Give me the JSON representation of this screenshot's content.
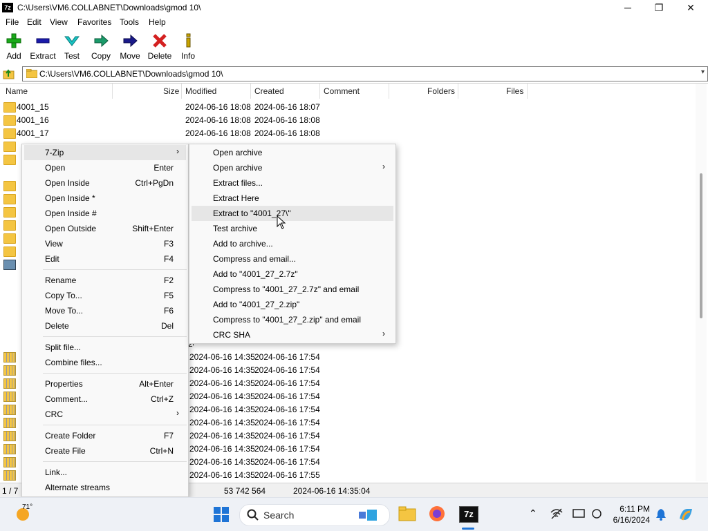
{
  "window": {
    "app_icon_label": "7z",
    "title": "C:\\Users\\VM6.COLLABNET\\Downloads\\gmod 10\\",
    "minimize_glyph": "─",
    "maximize_glyph": "❐",
    "close_glyph": "✕"
  },
  "menubar": [
    "File",
    "Edit",
    "View",
    "Favorites",
    "Tools",
    "Help"
  ],
  "toolbar": [
    {
      "label": "Add",
      "icon": "plus-icon",
      "color": "#1aaa1a"
    },
    {
      "label": "Extract",
      "icon": "minus-icon",
      "color": "#1a1aaa"
    },
    {
      "label": "Test",
      "icon": "check-icon",
      "color": "#19b3b3"
    },
    {
      "label": "Copy",
      "icon": "arrow-right-icon",
      "color": "#1a9a6a"
    },
    {
      "label": "Move",
      "icon": "arrow-right-icon",
      "color": "#1a1a8a"
    },
    {
      "label": "Delete",
      "icon": "x-icon",
      "color": "#d42020"
    },
    {
      "label": "Info",
      "icon": "info-icon",
      "color": "#c8a400"
    }
  ],
  "address": {
    "path": "C:\\Users\\VM6.COLLABNET\\Downloads\\gmod 10\\"
  },
  "columns": [
    "Name",
    "Size",
    "Modified",
    "Created",
    "Comment",
    "Folders",
    "Files"
  ],
  "rows": [
    {
      "name": "4001_15",
      "modified": "2024-06-16 18:08",
      "created": "2024-06-16 18:07"
    },
    {
      "name": "4001_16",
      "modified": "2024-06-16 18:08",
      "created": "2024-06-16 18:08"
    },
    {
      "name": "4001_17",
      "modified": "2024-06-16 18:08",
      "created": "2024-06-16 18:08"
    }
  ],
  "lower_rows": [
    {
      "modified": "2024-06-16 14:35",
      "created": "2024-06-16 17:54"
    },
    {
      "modified": "2024-06-16 14:35",
      "created": "2024-06-16 17:54"
    },
    {
      "modified": "2024-06-16 14:35",
      "created": "2024-06-16 17:54"
    },
    {
      "modified": "2024-06-16 14:35",
      "created": "2024-06-16 17:54"
    },
    {
      "modified": "2024-06-16 14:35",
      "created": "2024-06-16 17:54"
    },
    {
      "modified": "2024-06-16 14:35",
      "created": "2024-06-16 17:54"
    },
    {
      "modified": "2024-06-16 14:35",
      "created": "2024-06-16 17:54"
    },
    {
      "modified": "2024-06-16 14:35",
      "created": "2024-06-16 17:54"
    },
    {
      "modified": "2024-06-16 14:35",
      "created": "2024-06-16 17:54"
    },
    {
      "modified": "2024-06-16 14:35",
      "created": "2024-06-16 17:55"
    }
  ],
  "partial_row_text": "2024-06-16 14:35",
  "status": {
    "selection": "1 / 7",
    "size": "53 742 564",
    "date": "2024-06-16 14:35:04"
  },
  "context_menu": [
    {
      "label": "7-Zip",
      "shortcut": "",
      "submenu": true
    },
    {
      "label": "Open",
      "shortcut": "Enter"
    },
    {
      "label": "Open Inside",
      "shortcut": "Ctrl+PgDn"
    },
    {
      "label": "Open Inside *",
      "shortcut": ""
    },
    {
      "label": "Open Inside #",
      "shortcut": ""
    },
    {
      "label": "Open Outside",
      "shortcut": "Shift+Enter"
    },
    {
      "label": "View",
      "shortcut": "F3"
    },
    {
      "label": "Edit",
      "shortcut": "F4"
    },
    {
      "label": "Rename",
      "shortcut": "F2"
    },
    {
      "label": "Copy To...",
      "shortcut": "F5"
    },
    {
      "label": "Move To...",
      "shortcut": "F6"
    },
    {
      "label": "Delete",
      "shortcut": "Del"
    },
    {
      "label": "Split file...",
      "shortcut": ""
    },
    {
      "label": "Combine files...",
      "shortcut": ""
    },
    {
      "label": "Properties",
      "shortcut": "Alt+Enter"
    },
    {
      "label": "Comment...",
      "shortcut": "Ctrl+Z"
    },
    {
      "label": "CRC",
      "shortcut": "",
      "submenu": true
    },
    {
      "label": "Create Folder",
      "shortcut": "F7"
    },
    {
      "label": "Create File",
      "shortcut": "Ctrl+N"
    },
    {
      "label": "Link...",
      "shortcut": ""
    },
    {
      "label": "Alternate streams",
      "shortcut": ""
    }
  ],
  "submenu_7zip": [
    {
      "label": "Open archive"
    },
    {
      "label": "Open archive",
      "submenu": true
    },
    {
      "label": "Extract files..."
    },
    {
      "label": "Extract Here"
    },
    {
      "label": "Extract to \"4001_27\\\"",
      "highlighted": true
    },
    {
      "label": "Test archive"
    },
    {
      "label": "Add to archive..."
    },
    {
      "label": "Compress and email..."
    },
    {
      "label": "Add to \"4001_27_2.7z\""
    },
    {
      "label": "Compress to \"4001_27_2.7z\" and email"
    },
    {
      "label": "Add to \"4001_27_2.zip\""
    },
    {
      "label": "Compress to \"4001_27_2.zip\" and email"
    },
    {
      "label": "CRC SHA",
      "submenu": true
    }
  ],
  "taskbar": {
    "weather_temp": "71°",
    "search_placeholder": "Search",
    "time": "6:11 PM",
    "date": "6/16/2024",
    "sevenzip_label": "7z"
  }
}
